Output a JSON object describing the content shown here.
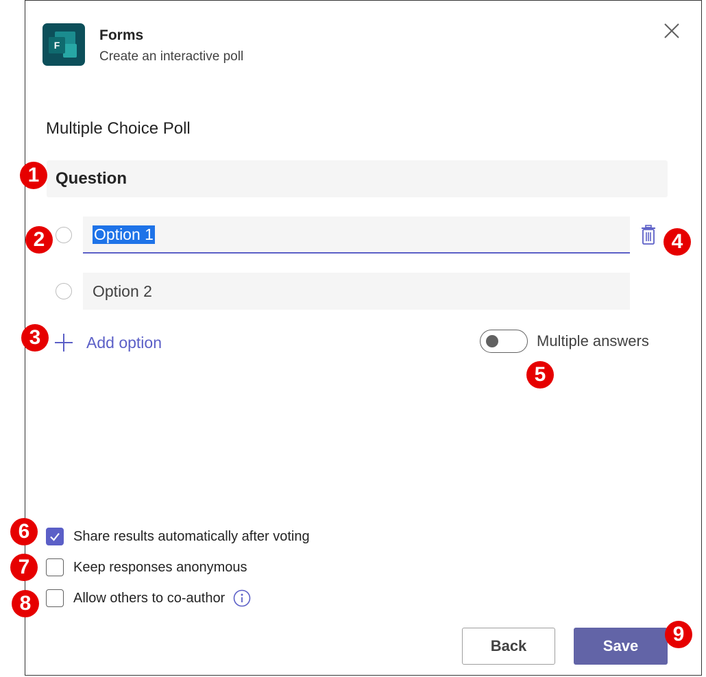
{
  "header": {
    "app_icon_letter": "F",
    "title": "Forms",
    "subtitle": "Create an interactive poll"
  },
  "poll": {
    "section_title": "Multiple Choice Poll",
    "question_label": "Question",
    "options": [
      {
        "label": "Option 1",
        "selected_text": true
      },
      {
        "label": "Option 2",
        "selected_text": false
      }
    ],
    "add_option_label": "Add option",
    "multiple_answers_label": "Multiple answers",
    "multiple_answers_on": false
  },
  "settings": [
    {
      "label": "Share results automatically after voting",
      "checked": true
    },
    {
      "label": "Keep responses anonymous",
      "checked": false
    },
    {
      "label": "Allow others to co-author",
      "checked": false
    }
  ],
  "footer": {
    "back_label": "Back",
    "save_label": "Save"
  },
  "markers": [
    "1",
    "2",
    "3",
    "4",
    "5",
    "6",
    "7",
    "8",
    "9"
  ],
  "colors": {
    "accent": "#5b5fc7",
    "save_button": "#6264a7",
    "marker": "#e60000",
    "app_icon": "#0c4f5a"
  }
}
